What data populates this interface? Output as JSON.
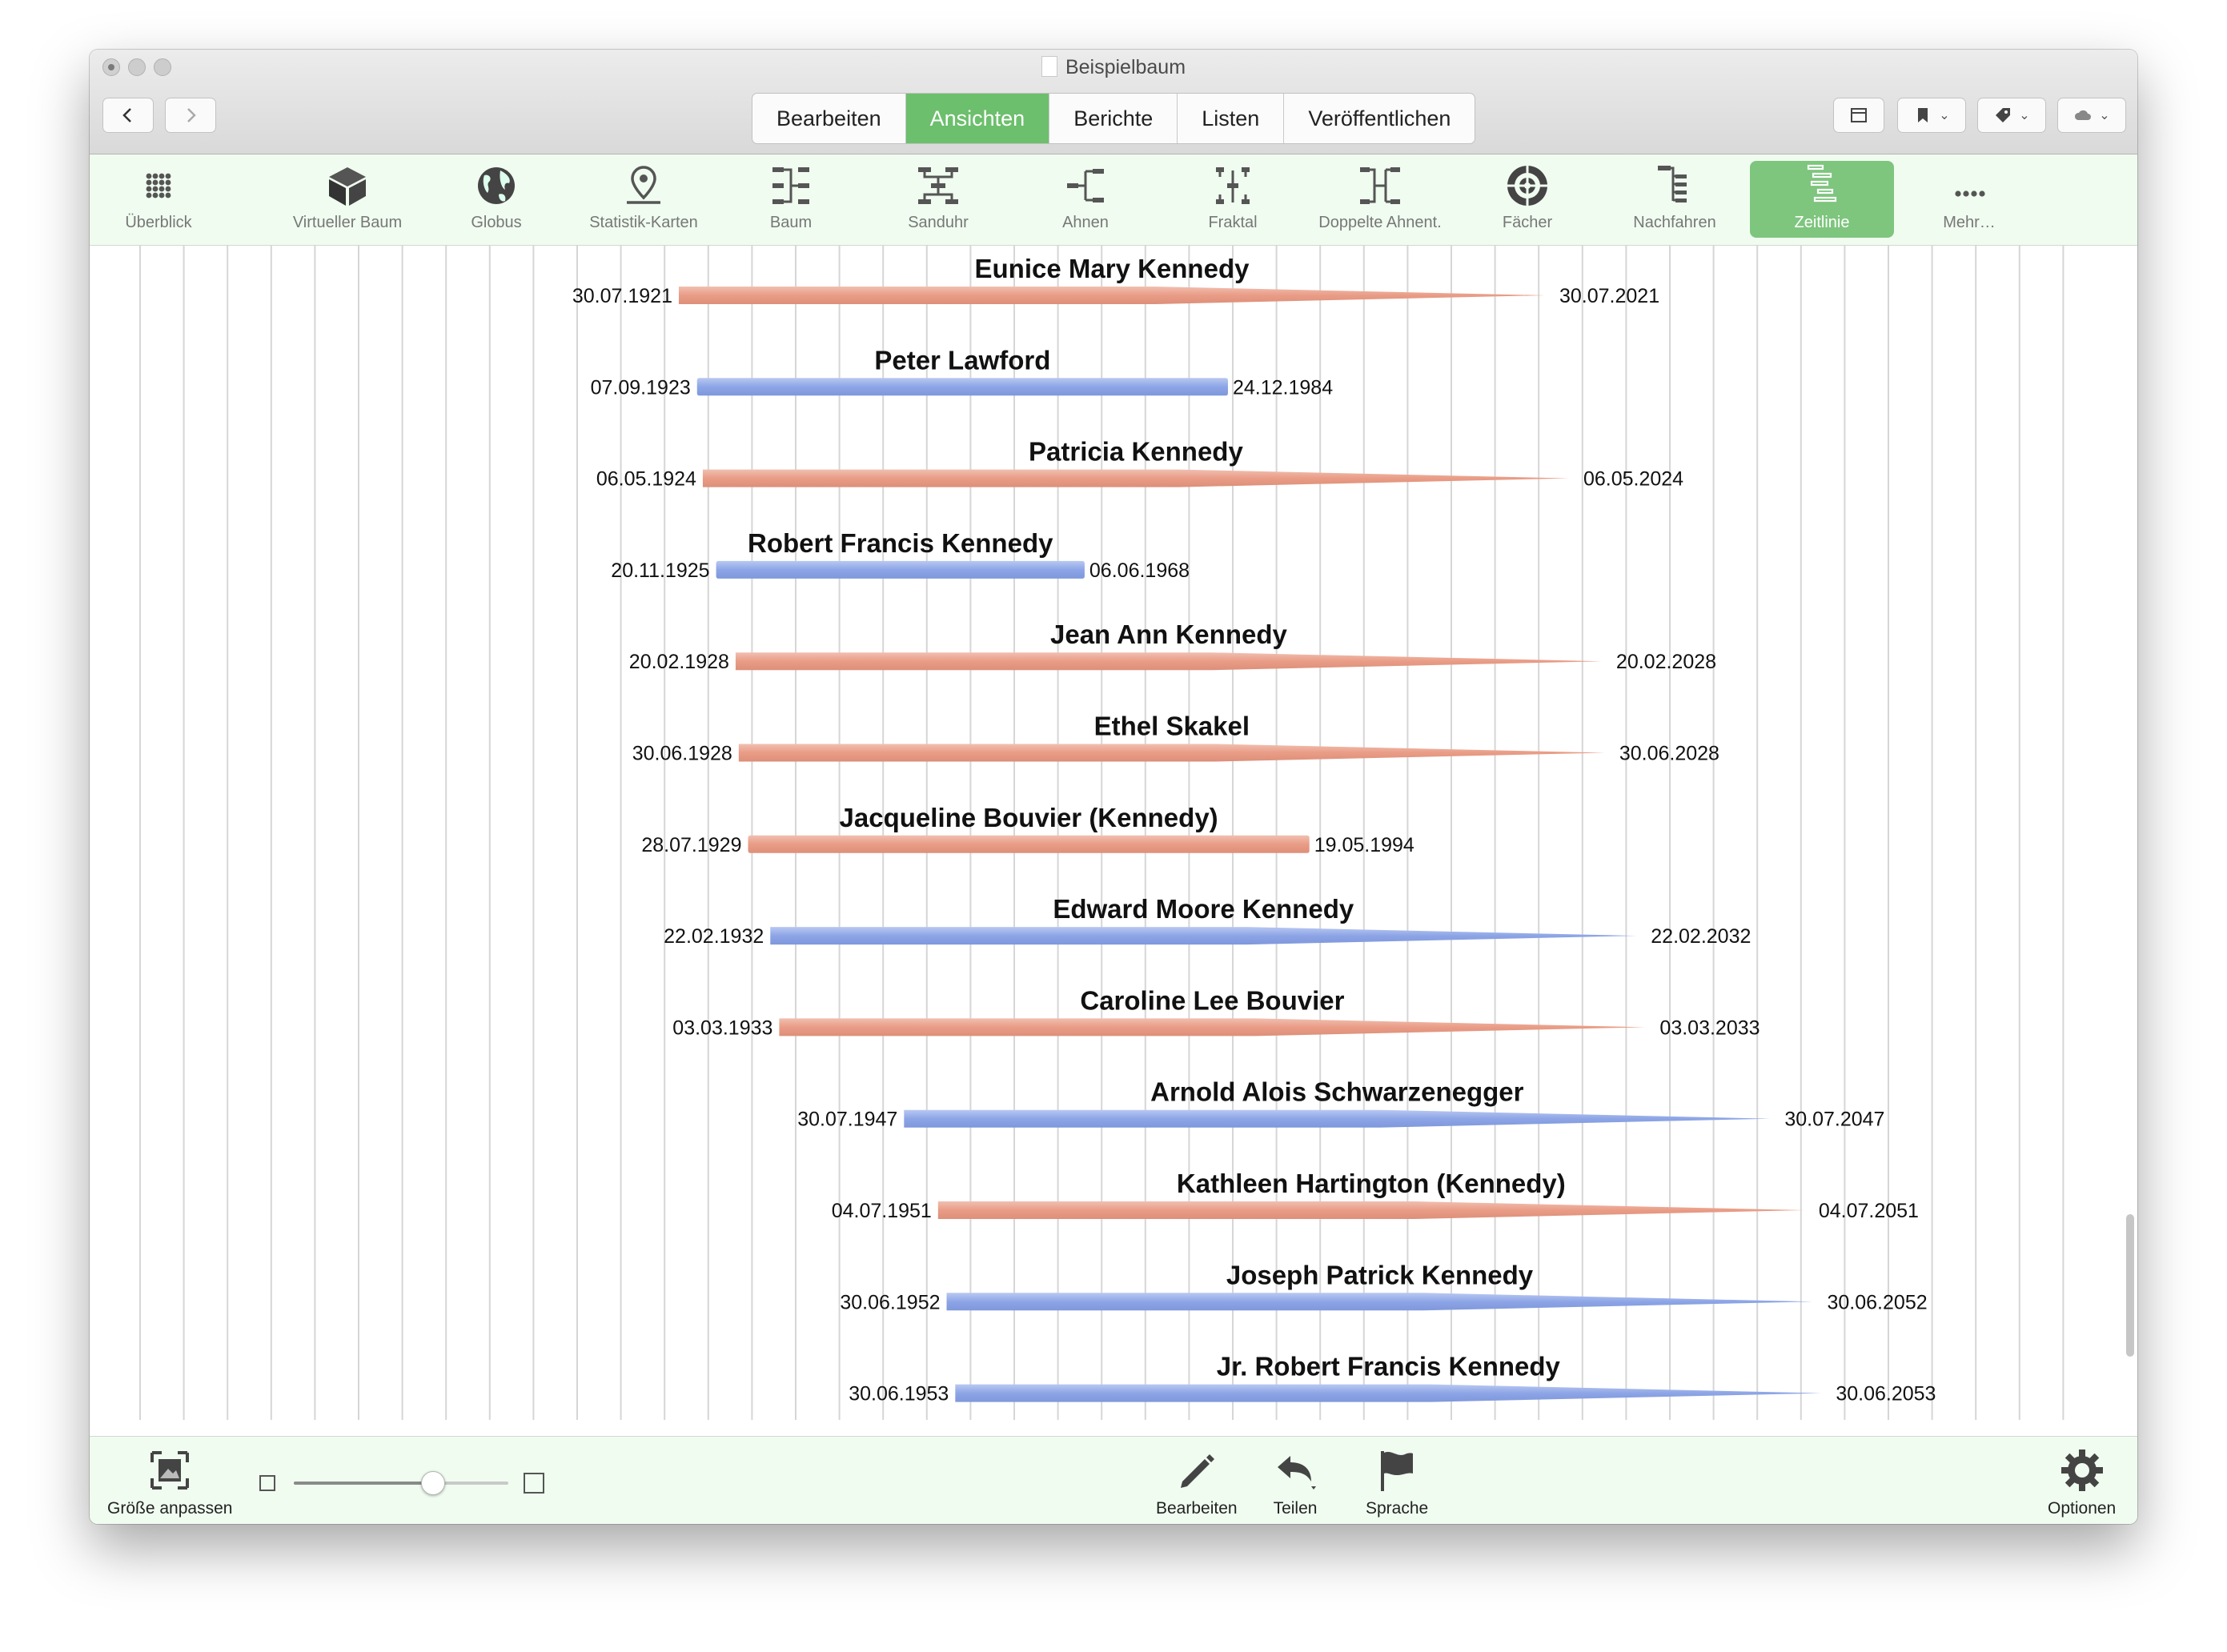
{
  "window": {
    "title": "Beispielbaum"
  },
  "tabs": [
    "Bearbeiten",
    "Ansichten",
    "Berichte",
    "Listen",
    "Veröffentlichen"
  ],
  "active_tab": "Ansichten",
  "toolbar": [
    {
      "label": "Überblick",
      "icon": "grid-dots-icon"
    },
    {
      "label": "Virtueller Baum",
      "icon": "cube-icon"
    },
    {
      "label": "Globus",
      "icon": "globe-icon"
    },
    {
      "label": "Statistik-Karten",
      "icon": "map-pin-icon"
    },
    {
      "label": "Baum",
      "icon": "tree-chart-icon"
    },
    {
      "label": "Sanduhr",
      "icon": "hourglass-chart-icon"
    },
    {
      "label": "Ahnen",
      "icon": "ancestors-chart-icon"
    },
    {
      "label": "Fraktal",
      "icon": "fractal-chart-icon"
    },
    {
      "label": "Doppelte Ahnent.",
      "icon": "duplicate-ancestors-icon"
    },
    {
      "label": "Fächer",
      "icon": "fan-chart-icon"
    },
    {
      "label": "Nachfahren",
      "icon": "descendants-chart-icon"
    },
    {
      "label": "Zeitlinie",
      "icon": "timeline-icon"
    },
    {
      "label": "Mehr…",
      "icon": "more-dots-icon"
    }
  ],
  "active_tool": "Zeitlinie",
  "timeline": [
    {
      "name": "Eunice Mary Kennedy",
      "start": "30.07.1921",
      "end": "30.07.2021",
      "sex": "female",
      "estimated_end": true
    },
    {
      "name": "Peter Lawford",
      "start": "07.09.1923",
      "end": "24.12.1984",
      "sex": "male",
      "estimated_end": false
    },
    {
      "name": "Patricia Kennedy",
      "start": "06.05.1924",
      "end": "06.05.2024",
      "sex": "female",
      "estimated_end": true
    },
    {
      "name": "Robert Francis Kennedy",
      "start": "20.11.1925",
      "end": "06.06.1968",
      "sex": "male",
      "estimated_end": false
    },
    {
      "name": "Jean Ann Kennedy",
      "start": "20.02.1928",
      "end": "20.02.2028",
      "sex": "female",
      "estimated_end": true
    },
    {
      "name": "Ethel Skakel",
      "start": "30.06.1928",
      "end": "30.06.2028",
      "sex": "female",
      "estimated_end": true
    },
    {
      "name": "Jacqueline Bouvier (Kennedy)",
      "start": "28.07.1929",
      "end": "19.05.1994",
      "sex": "female",
      "estimated_end": false
    },
    {
      "name": "Edward Moore Kennedy",
      "start": "22.02.1932",
      "end": "22.02.2032",
      "sex": "male",
      "estimated_end": true
    },
    {
      "name": "Caroline Lee Bouvier",
      "start": "03.03.1933",
      "end": "03.03.2033",
      "sex": "female",
      "estimated_end": true
    },
    {
      "name": "Arnold Alois Schwarzenegger",
      "start": "30.07.1947",
      "end": "30.07.2047",
      "sex": "male",
      "estimated_end": true
    },
    {
      "name": "Kathleen Hartington (Kennedy)",
      "start": "04.07.1951",
      "end": "04.07.2051",
      "sex": "female",
      "estimated_end": true
    },
    {
      "name": "Joseph Patrick Kennedy",
      "start": "30.06.1952",
      "end": "30.06.2052",
      "sex": "male",
      "estimated_end": true
    },
    {
      "name": "Jr. Robert Francis Kennedy",
      "start": "30.06.1953",
      "end": "30.06.2053",
      "sex": "male",
      "estimated_end": true
    }
  ],
  "colors": {
    "female": "#e9a592",
    "male": "#98aee6",
    "accent": "#6cbf6c"
  },
  "bottombar": {
    "fit_label": "Größe anpassen",
    "zoom_level": 0.65,
    "edit_label": "Bearbeiten",
    "share_label": "Teilen",
    "language_label": "Sprache",
    "options_label": "Optionen"
  }
}
